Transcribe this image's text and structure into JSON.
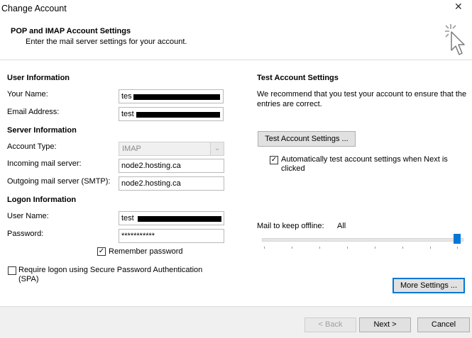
{
  "window": {
    "title": "Change Account",
    "close_glyph": "✕"
  },
  "header": {
    "heading": "POP and IMAP Account Settings",
    "subheading": "Enter the mail server settings for your account."
  },
  "user_info": {
    "section": "User Information",
    "name_label": "Your Name:",
    "name_value": "tes",
    "email_label": "Email Address:",
    "email_value": "test"
  },
  "server_info": {
    "section": "Server Information",
    "account_type_label": "Account Type:",
    "account_type_value": "IMAP",
    "incoming_label": "Incoming mail server:",
    "incoming_value": "node2.hosting.ca",
    "outgoing_label": "Outgoing mail server (SMTP):",
    "outgoing_value": "node2.hosting.ca"
  },
  "logon_info": {
    "section": "Logon Information",
    "username_label": "User Name:",
    "username_value": "test",
    "password_label": "Password:",
    "password_value": "***********",
    "remember_label": "Remember password",
    "remember_checked": true,
    "spa_label": "Require logon using Secure Password Authentication (SPA)",
    "spa_checked": false
  },
  "test_settings": {
    "section": "Test Account Settings",
    "description": "We recommend that you test your account to ensure that the entries are correct.",
    "test_button": "Test Account Settings ...",
    "auto_test_label": "Automatically test account settings when Next is clicked",
    "auto_test_checked": true
  },
  "offline": {
    "label": "Mail to keep offline:",
    "value": "All",
    "slider_level_fraction": 1.0
  },
  "buttons": {
    "more_settings": "More Settings ...",
    "back": "< Back",
    "next": "Next >",
    "cancel": "Cancel"
  },
  "icons": {
    "window_close": "close-icon",
    "header_graphic": "cursor-click-icon",
    "dropdown": "chevron-down-icon",
    "check": "checkmark-icon"
  },
  "colors": {
    "accent": "#0078d7",
    "footer_bg": "#f0f0f0",
    "redaction": "#000000"
  }
}
